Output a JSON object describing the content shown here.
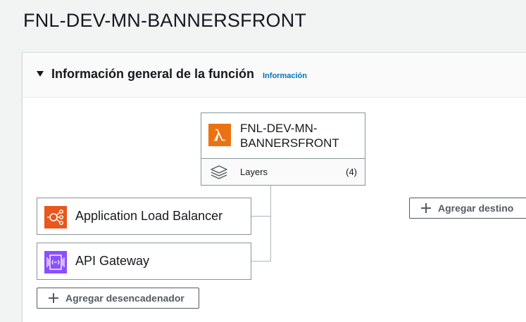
{
  "page": {
    "title": "FNL-DEV-MN-BANNERSFRONT"
  },
  "panel": {
    "title": "Información general de la función",
    "info_link": "Información"
  },
  "function": {
    "name": "FNL-DEV-MN-BANNERSFRONT",
    "layers_label": "Layers",
    "layers_count": "(4)"
  },
  "triggers": [
    {
      "label": "Application Load Balancer",
      "icon": "load-balancer-icon",
      "color": "#e8571b"
    },
    {
      "label": "API Gateway",
      "icon": "api-gateway-icon",
      "color": "#8c4fff"
    }
  ],
  "buttons": {
    "add_trigger": "Agregar desencadenador",
    "add_destination": "Agregar destino"
  },
  "colors": {
    "lambda": "#ec7211",
    "link": "#0073bb",
    "border": "#879596"
  }
}
